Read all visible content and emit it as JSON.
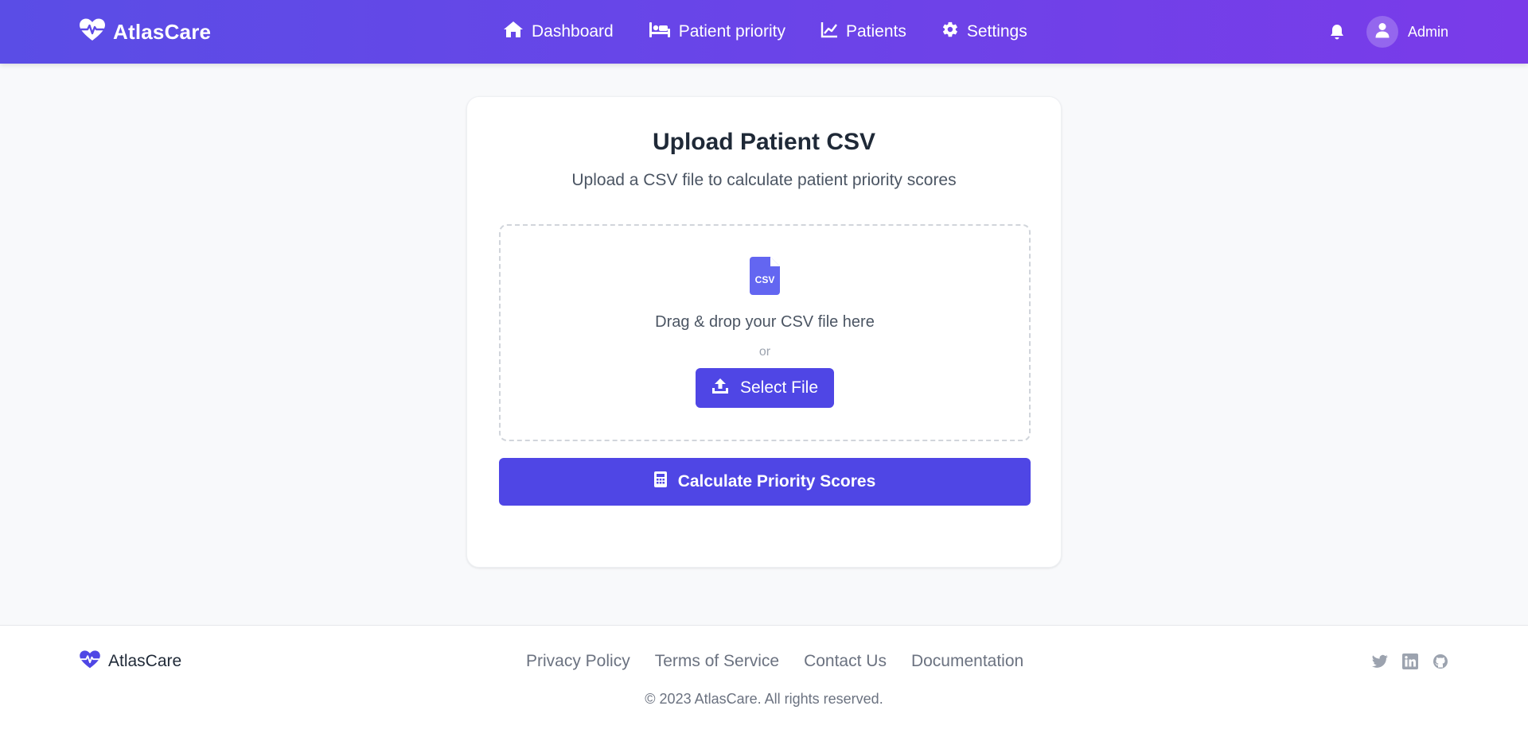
{
  "brand": {
    "name": "AtlasCare",
    "icon": "heart-pulse-icon"
  },
  "nav": {
    "links": [
      {
        "label": "Dashboard",
        "icon": "home-icon"
      },
      {
        "label": "Patient priority",
        "icon": "bed-icon"
      },
      {
        "label": "Patients",
        "icon": "chart-line-icon"
      },
      {
        "label": "Settings",
        "icon": "gear-icon"
      }
    ],
    "notifications_icon": "bell-icon",
    "user": {
      "name": "Admin",
      "icon": "user-icon"
    }
  },
  "upload": {
    "title": "Upload Patient CSV",
    "subtitle": "Upload a CSV file to calculate patient priority scores",
    "dropzone": {
      "icon": "csv-file-icon",
      "icon_label": "CSV",
      "drag_text": "Drag & drop your CSV file here",
      "or_text": "or",
      "select_button": "Select File"
    },
    "calculate_button": "Calculate Priority Scores"
  },
  "footer": {
    "brand": "AtlasCare",
    "links": [
      "Privacy Policy",
      "Terms of Service",
      "Contact Us",
      "Documentation"
    ],
    "social": [
      "twitter-icon",
      "linkedin-icon",
      "github-icon"
    ],
    "copyright": "© 2023 AtlasCare. All rights reserved."
  },
  "colors": {
    "primary": "#4f46e5",
    "header_gradient_start": "#5a4de6",
    "header_gradient_end": "#7a3be9",
    "background": "#f8f9fb"
  }
}
